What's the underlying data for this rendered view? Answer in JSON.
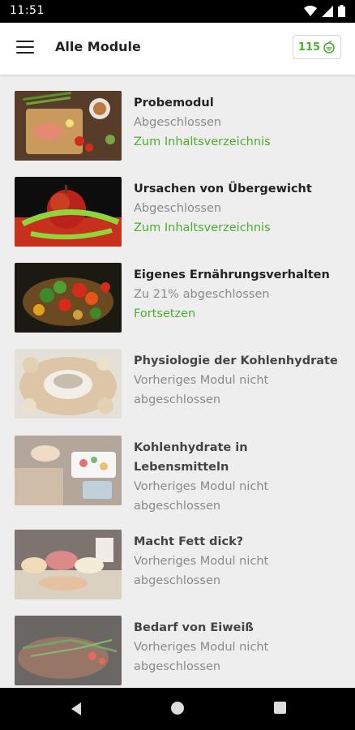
{
  "status": {
    "time": "11:51"
  },
  "header": {
    "title": "Alle Module",
    "coins": "115"
  },
  "modules": [
    {
      "title": "Probemodul",
      "status": "Abgeschlossen",
      "action": "Zum Inhaltsverzeichnis"
    },
    {
      "title": "Ursachen von Übergewicht",
      "status": "Abgeschlossen",
      "action": "Zum Inhaltsverzeichnis"
    },
    {
      "title": "Eigenes Ernährungsverhalten",
      "status": "Zu 21% abgeschlossen",
      "action": "Fortsetzen"
    },
    {
      "title": "Physiologie der Kohlenhydrate",
      "status_line1": "Vorheriges Modul nicht",
      "status_line2": "abgeschlossen"
    },
    {
      "title_line1": "Kohlenhydrate in",
      "title_line2": "Lebensmitteln",
      "status_line1": "Vorheriges Modul nicht",
      "status_line2": "abgeschlossen"
    },
    {
      "title": "Macht Fett dick?",
      "status_line1": "Vorheriges Modul nicht",
      "status_line2": "abgeschlossen"
    },
    {
      "title": "Bedarf von Eiweiß",
      "status_line1": "Vorheriges Modul nicht",
      "status_line2": "abgeschlossen"
    }
  ],
  "colors": {
    "accent": "#4caf2d",
    "muted": "#8a8a8a"
  },
  "icons": [
    "menu-icon",
    "coin-icon",
    "wifi-icon",
    "signal-icon",
    "battery-icon",
    "back-icon",
    "home-icon",
    "recents-icon"
  ]
}
